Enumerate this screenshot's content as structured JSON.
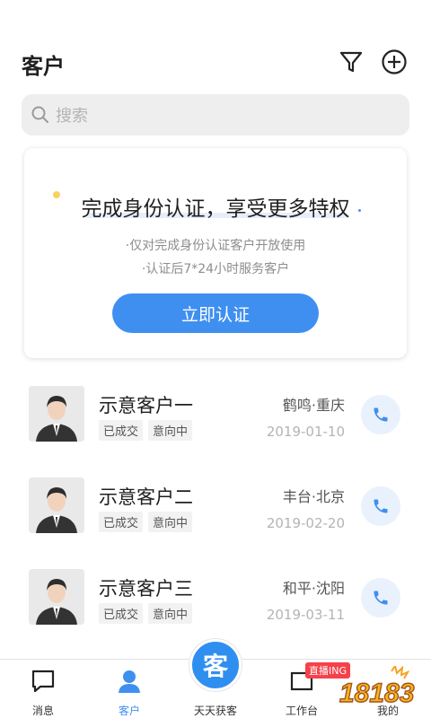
{
  "header": {
    "title": "客户",
    "filter_icon": "filter-icon",
    "add_icon": "plus-circle-icon"
  },
  "search": {
    "placeholder": "搜索",
    "icon": "search-icon"
  },
  "auth_card": {
    "title": "完成身份认证，享受更多特权",
    "line1": "·仅对完成身份认证客户开放使用",
    "line2": "·认证后7*24小时服务客户",
    "button": "立即认证"
  },
  "customers": [
    {
      "name": "示意客户一",
      "tags": [
        "已成交",
        "意向中"
      ],
      "location": "鹤鸣·重庆",
      "date": "2019-01-10"
    },
    {
      "name": "示意客户二",
      "tags": [
        "已成交",
        "意向中"
      ],
      "location": "丰台·北京",
      "date": "2019-02-20"
    },
    {
      "name": "示意客户三",
      "tags": [
        "已成交",
        "意向中"
      ],
      "location": "和平·沈阳",
      "date": "2019-03-11"
    }
  ],
  "nav": {
    "messages": "消息",
    "customers": "客户",
    "center_glyph": "客",
    "center_label": "天天获客",
    "workbench": "工作台",
    "workbench_badge": "直播ING",
    "mine": "我的"
  },
  "colors": {
    "accent": "#3f8ff0",
    "badge": "#f4414a"
  },
  "watermark_text": "18183"
}
